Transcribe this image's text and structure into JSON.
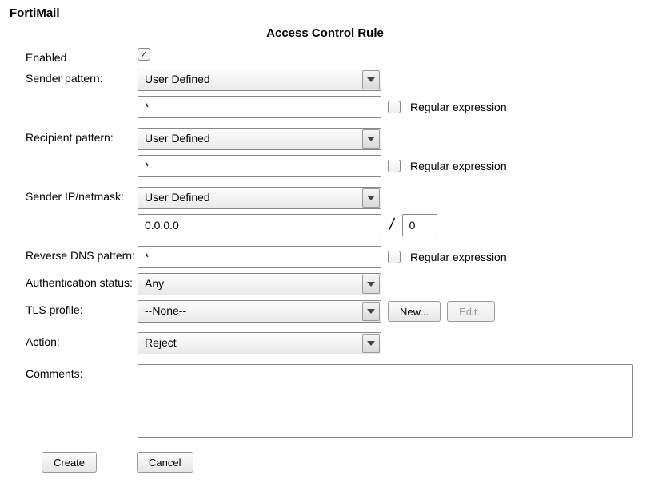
{
  "product": "FortiMail",
  "title": "Access Control Rule",
  "labels": {
    "enabled": "Enabled",
    "sender_pattern": "Sender pattern:",
    "recipient_pattern": "Recipient pattern:",
    "sender_ip": "Sender IP/netmask:",
    "reverse_dns": "Reverse DNS pattern:",
    "auth_status": "Authentication status:",
    "tls_profile": "TLS profile:",
    "action": "Action:",
    "comments": "Comments:",
    "regex": "Regular expression"
  },
  "values": {
    "enabled_checked": true,
    "sender_pattern_select": "User Defined",
    "sender_pattern_value": "*",
    "sender_regex_checked": false,
    "recipient_pattern_select": "User Defined",
    "recipient_pattern_value": "*",
    "recipient_regex_checked": false,
    "sender_ip_select": "User Defined",
    "sender_ip_value": "0.0.0.0",
    "sender_netmask": "0",
    "reverse_dns_value": "*",
    "reverse_dns_regex_checked": false,
    "auth_status_select": "Any",
    "tls_profile_select": "--None--",
    "action_select": "Reject",
    "comments": ""
  },
  "buttons": {
    "new": "New...",
    "edit": "Edit..",
    "create": "Create",
    "cancel": "Cancel"
  },
  "slash": "/"
}
